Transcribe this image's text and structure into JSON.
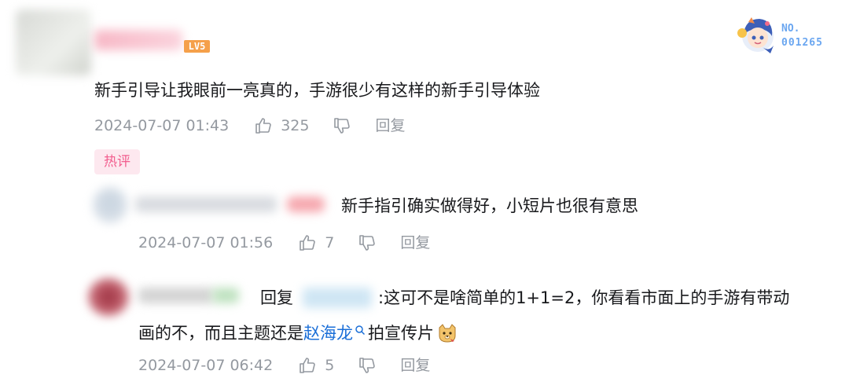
{
  "main_comment": {
    "level": "LV5",
    "fan_badge": {
      "no_label": "NO.",
      "number": "001265"
    },
    "text": "新手引导让我眼前一亮真的，手游很少有这样的新手引导体验",
    "time": "2024-07-07 01:43",
    "likes": "325",
    "reply_label": "回复",
    "hot_tag": "热评"
  },
  "replies": [
    {
      "text": "新手指引确实做得好，小短片也很有意思",
      "time": "2024-07-07 01:56",
      "likes": "7",
      "reply_label": "回复"
    },
    {
      "reply_prefix": "回复",
      "text_line1": ":这可不是啥简单的1+1=2，你看看市面上的手游有带动",
      "text_line2_before": "画的不，而且主题还是",
      "link_text": "赵海龙",
      "text_line2_after": "拍宣传片",
      "time": "2024-07-07 06:42",
      "likes": "5",
      "reply_label": "回复"
    }
  ]
}
